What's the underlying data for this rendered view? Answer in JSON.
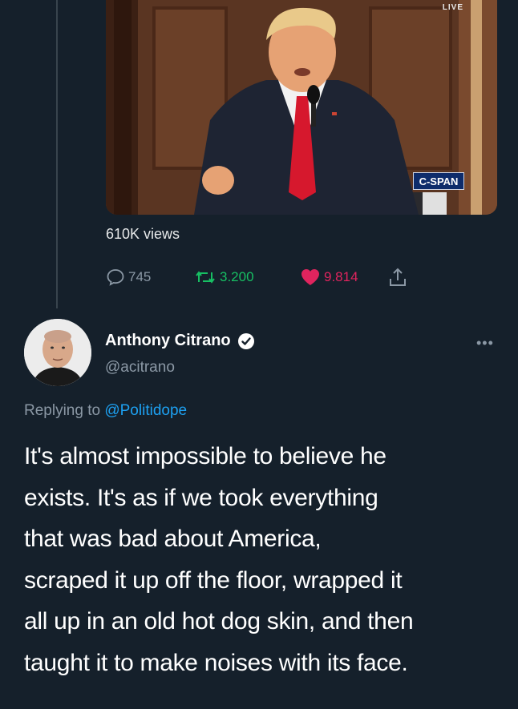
{
  "video": {
    "live_label": "LIVE",
    "network_logo": "C-SPAN",
    "views_text": "610K views"
  },
  "actions": {
    "replies": "745",
    "retweets": "3.200",
    "likes": "9.814",
    "icons": [
      "reply-icon",
      "retweet-icon",
      "heart-icon",
      "share-icon"
    ]
  },
  "reply_tweet": {
    "display_name": "Anthony Citrano",
    "handle": "@acitrano",
    "verified_icon": "verified-badge-icon",
    "replying_prefix": "Replying to",
    "replying_to": "@Politidope",
    "more_icon": "more-icon",
    "text": "It's almost impossible to believe he\nexists. It's as if we took everything\nthat was bad about America,\nscraped it up off the floor, wrapped it\nall up in an old hot dog skin, and then\ntaught it to make noises with its face."
  },
  "colors": {
    "background": "#15202b",
    "muted": "#8b98a5",
    "link": "#1da1f2",
    "retweet": "#17bf63",
    "like": "#e0245e"
  }
}
